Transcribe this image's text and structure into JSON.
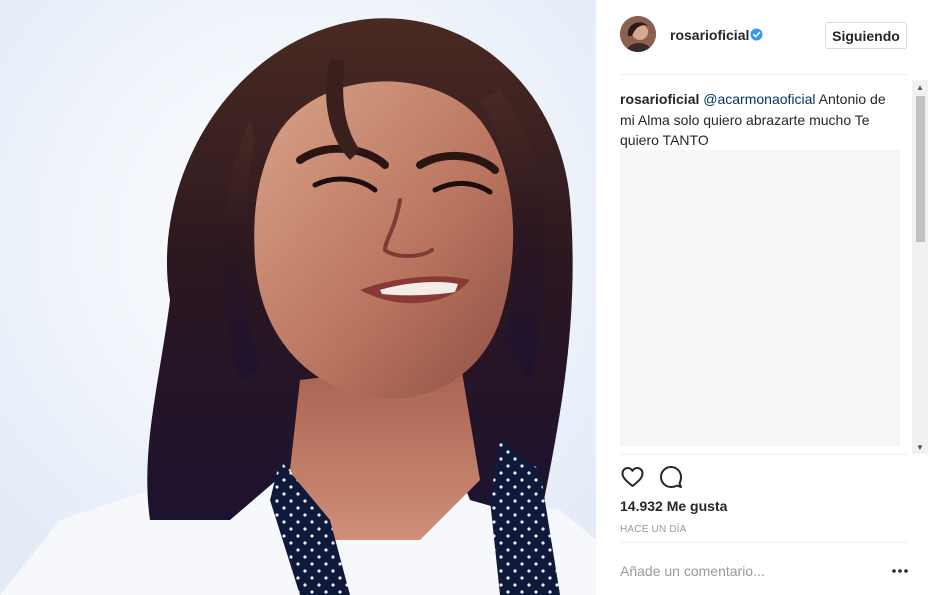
{
  "post": {
    "username": "rosarioficial",
    "follow_button": "Siguiendo",
    "caption": {
      "user": "rosarioficial",
      "mention": "@acarmonaoficial",
      "text": "Antonio de mi Alma solo quiero abrazarte mucho Te quiero TANTO"
    },
    "likes": "14.932 Me gusta",
    "timestamp": "HACE UN DÍA",
    "comment_placeholder": "Añade un comentario..."
  },
  "icons": {
    "verified": "verified-badge-icon",
    "like": "heart-outline-icon",
    "comment": "speech-bubble-icon",
    "more": "ellipsis-icon"
  },
  "colors": {
    "verified_blue": "#3897f0",
    "mention": "#003569",
    "text": "#262626",
    "muted": "#999999",
    "divider": "#efefef"
  }
}
